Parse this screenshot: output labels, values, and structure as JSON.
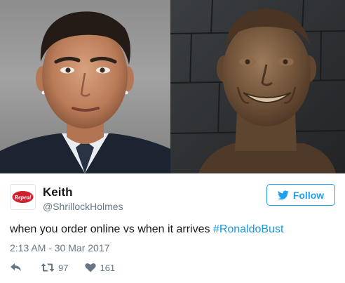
{
  "images": {
    "left": {
      "subject": "man-photo"
    },
    "right": {
      "subject": "bronze-bust-photo"
    }
  },
  "tweet": {
    "author_name": "Keith",
    "author_handle": "@ShrillockHolmes",
    "avatar_text": "Repeal",
    "follow_label": "Follow",
    "text_prefix": "when you order online vs when it arrives ",
    "hashtag": "#RonaldoBust",
    "timestamp": "2:13 AM - 30 Mar 2017",
    "retweet_count": "97",
    "like_count": "161"
  },
  "colors": {
    "accent": "#1da1f2",
    "hashtag": "#1b95e0",
    "muted": "#657786",
    "text": "#14171a",
    "avatar_red": "#d0202e"
  },
  "icons": [
    "bird-icon",
    "reply-icon",
    "retweet-icon",
    "heart-icon"
  ]
}
